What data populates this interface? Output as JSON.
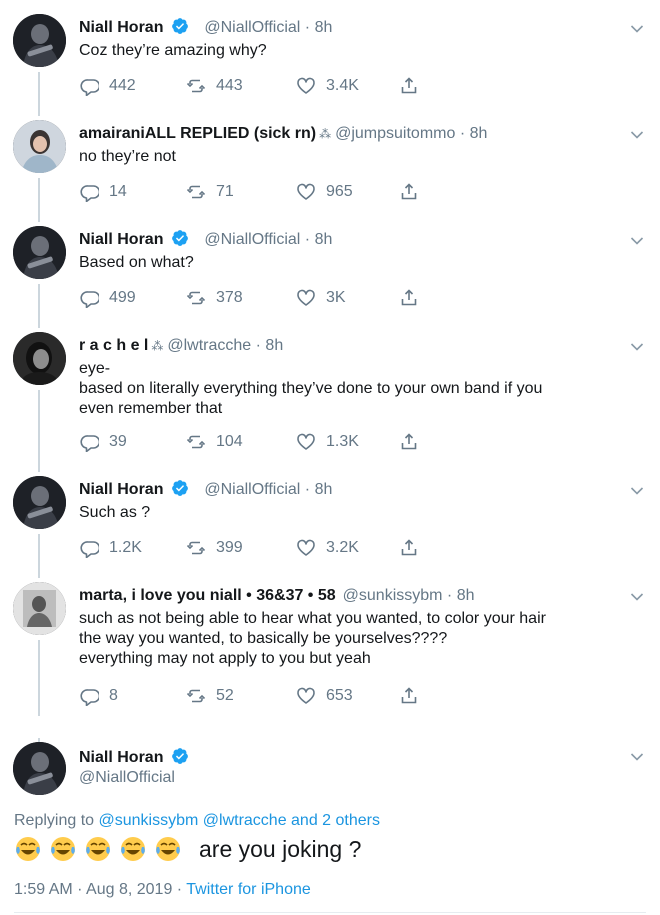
{
  "thread": [
    {
      "name": "Niall Horan",
      "verified": true,
      "handle": "@NiallOfficial",
      "time": "8h",
      "text": "Coz they’re amazing why?",
      "replies": "442",
      "retweets": "443",
      "likes": "3.4K"
    },
    {
      "name": "amairaniALL REPLIED (sick rn)",
      "name_glyph": "⁂",
      "verified": false,
      "handle": "@jumpsuitommo",
      "time": "8h",
      "text": "no they’re not",
      "replies": "14",
      "retweets": "71",
      "likes": "965"
    },
    {
      "name": "Niall Horan",
      "verified": true,
      "handle": "@NiallOfficial",
      "time": "8h",
      "text": "Based on what?",
      "replies": "499",
      "retweets": "378",
      "likes": "3K"
    },
    {
      "name": "r a c h e l",
      "name_glyph": "⁂",
      "verified": false,
      "handle": "@lwtracche",
      "time": "8h",
      "text": "eye-\nbased on literally everything they’ve done to your own band if you\neven remember that",
      "replies": "39",
      "retweets": "104",
      "likes": "1.3K"
    },
    {
      "name": "Niall Horan",
      "verified": true,
      "handle": "@NiallOfficial",
      "time": "8h",
      "text": "Such as ?",
      "replies": "1.2K",
      "retweets": "399",
      "likes": "3.2K"
    },
    {
      "name": "marta, i love you niall • 36&37 • 58",
      "verified": false,
      "handle": "@sunkissybm",
      "time": "8h",
      "text": "such as not being able to hear what you wanted, to color your hair\nthe way you wanted, to basically be yourselves????\neverything may not apply to you but yeah",
      "replies": "8",
      "retweets": "52",
      "likes": "653"
    }
  ],
  "main_tweet": {
    "name": "Niall Horan",
    "verified": true,
    "handle": "@NiallOfficial",
    "replying_prefix": "Replying to",
    "replying_users": "@sunkissybm @lwtracche and 2 others",
    "emoji": "😂😂😂😂😂",
    "text": "are you joking ?",
    "timestamp": "1:59 AM · Aug 8, 2019 · ",
    "source": "Twitter for iPhone"
  },
  "icons": {
    "reply": "reply-icon",
    "retweet": "retweet-icon",
    "like": "heart-icon",
    "share": "share-icon",
    "caret": "chevron-down-icon",
    "verified": "verified-badge-icon"
  },
  "colors": {
    "text": "#14171a",
    "secondary": "#657786",
    "link": "#1b95e0",
    "verified": "#1da1f2",
    "thread_line": "#ccd6dd",
    "divider": "#e6ecf0"
  }
}
